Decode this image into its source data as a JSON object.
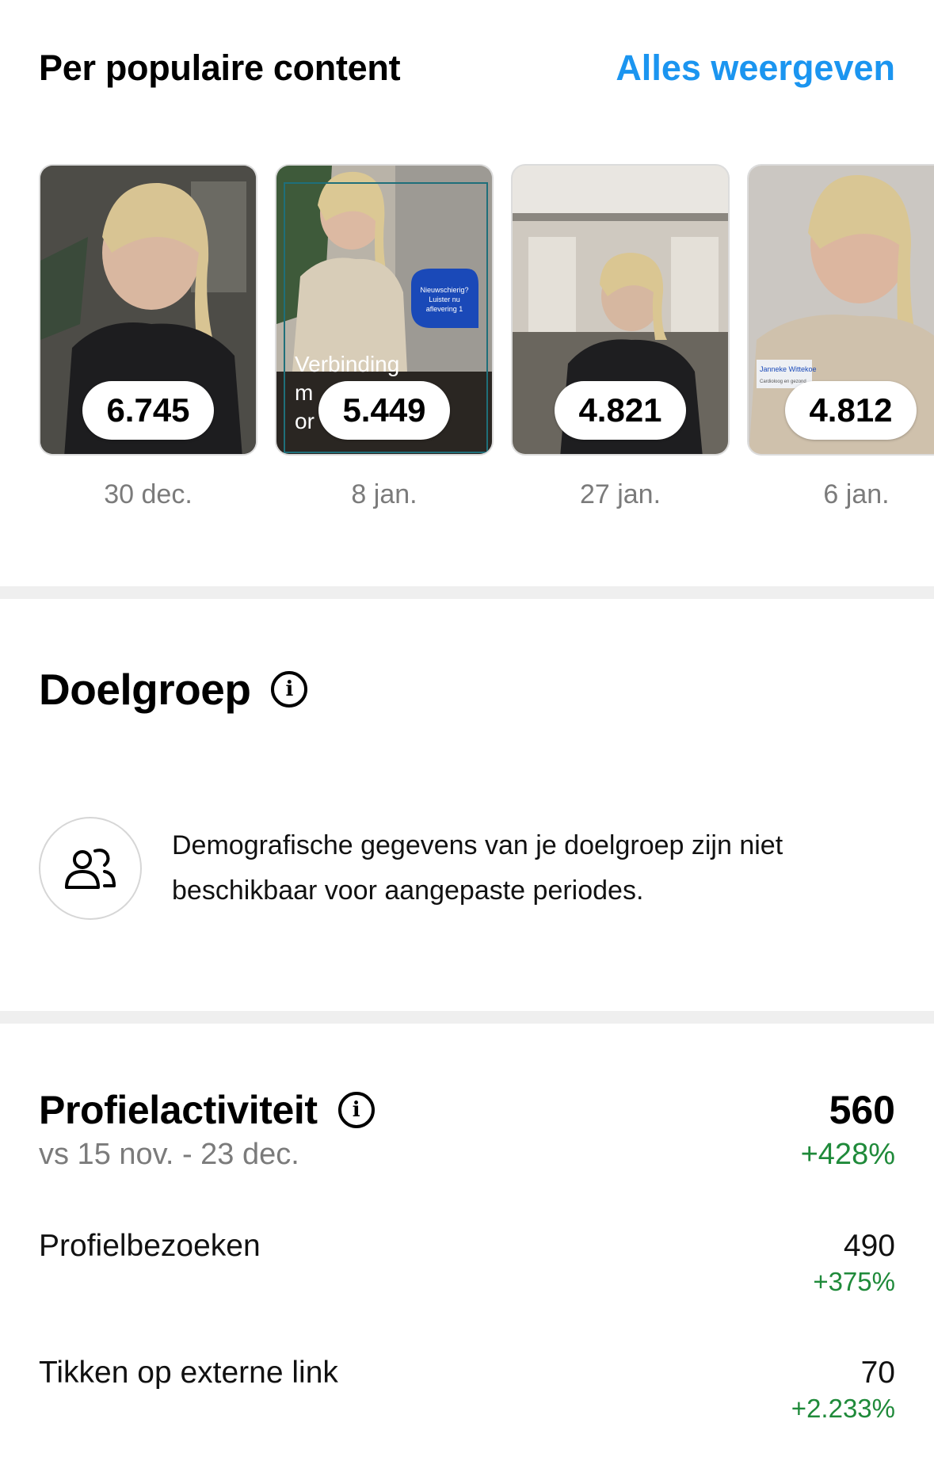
{
  "popular": {
    "title": "Per populaire content",
    "view_all": "Alles weergeven",
    "items": [
      {
        "count": "6.745",
        "date": "30 dec."
      },
      {
        "count": "5.449",
        "date": "8 jan.",
        "overlay_text": "Verbinding",
        "badge": "Nieuwschierig? Luister nu aflevering 1"
      },
      {
        "count": "4.821",
        "date": "27 jan."
      },
      {
        "count": "4.812",
        "date": "6 jan.",
        "caption": "Janneke Wittekoe"
      }
    ]
  },
  "audience": {
    "title": "Doelgroep",
    "message": "Demografische gegevens van je doelgroep zijn niet beschikbaar voor aangepaste periodes."
  },
  "profile_activity": {
    "title": "Profielactiviteit",
    "comparison": "vs 15 nov. - 23 dec.",
    "total": "560",
    "total_change": "+428%",
    "metrics": [
      {
        "label": "Profielbezoeken",
        "value": "490",
        "change": "+375%"
      },
      {
        "label": "Tikken op externe link",
        "value": "70",
        "change": "+2.233%"
      }
    ]
  },
  "icons": {
    "info": "info-icon",
    "audience": "people-icon"
  },
  "colors": {
    "link": "#1b95f0",
    "positive": "#1f8a3a",
    "muted": "#7b7b7b"
  }
}
